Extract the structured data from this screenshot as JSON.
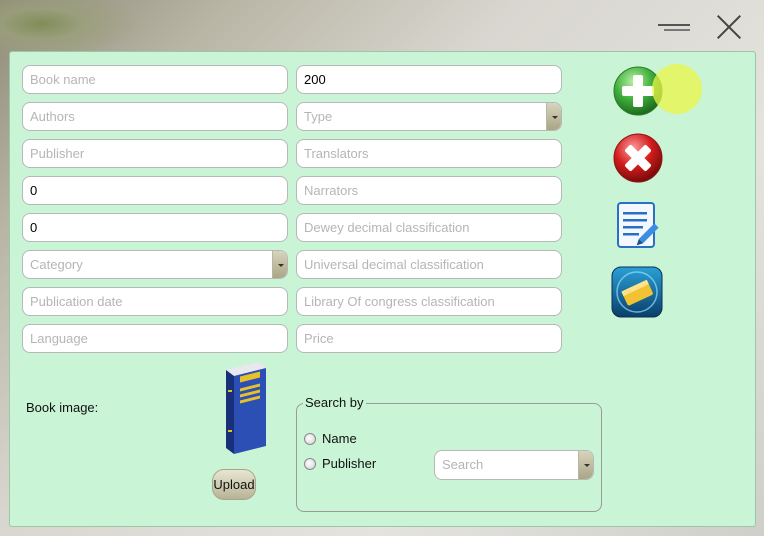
{
  "window": {
    "minimize_icon": "minimize-icon",
    "close_icon": "close-icon"
  },
  "form": {
    "left": [
      {
        "name": "book-name-field",
        "value": "",
        "placeholder": "Book name"
      },
      {
        "name": "authors-field",
        "value": "",
        "placeholder": "Authors"
      },
      {
        "name": "publisher-field",
        "value": "",
        "placeholder": "Publisher"
      },
      {
        "name": "left-number-field-1",
        "value": "0",
        "placeholder": ""
      },
      {
        "name": "left-number-field-2",
        "value": "0",
        "placeholder": ""
      },
      {
        "name": "category-combo",
        "value": "",
        "placeholder": "Category",
        "combo": true
      },
      {
        "name": "publication-date-field",
        "value": "",
        "placeholder": "Publication date"
      },
      {
        "name": "language-field",
        "value": "",
        "placeholder": "Language"
      }
    ],
    "right": [
      {
        "name": "right-number-field",
        "value": "200",
        "placeholder": ""
      },
      {
        "name": "type-combo",
        "value": "",
        "placeholder": "Type",
        "combo": true
      },
      {
        "name": "translators-field",
        "value": "",
        "placeholder": "Translators"
      },
      {
        "name": "narrators-field",
        "value": "",
        "placeholder": "Narrators"
      },
      {
        "name": "dewey-field",
        "value": "",
        "placeholder": "Dewey decimal classification"
      },
      {
        "name": "universal-decimal-field",
        "value": "",
        "placeholder": "Universal decimal classification"
      },
      {
        "name": "library-of-congress-field",
        "value": "",
        "placeholder": "Library Of congress classification"
      },
      {
        "name": "price-field",
        "value": "",
        "placeholder": "Price"
      }
    ]
  },
  "actions": {
    "add_icon": "add-icon",
    "delete_icon": "delete-icon",
    "edit_icon": "edit-icon",
    "print_icon": "print-icon"
  },
  "book_image": {
    "label": "Book image:",
    "upload_label": "Upload",
    "icon": "book-icon"
  },
  "search": {
    "legend": "Search by",
    "options": [
      "Name",
      "Publisher"
    ],
    "combo_placeholder": "Search"
  },
  "colors": {
    "panel": "#c9f4d6",
    "accent_green": "#3fae3c",
    "accent_red": "#d21c1c"
  }
}
